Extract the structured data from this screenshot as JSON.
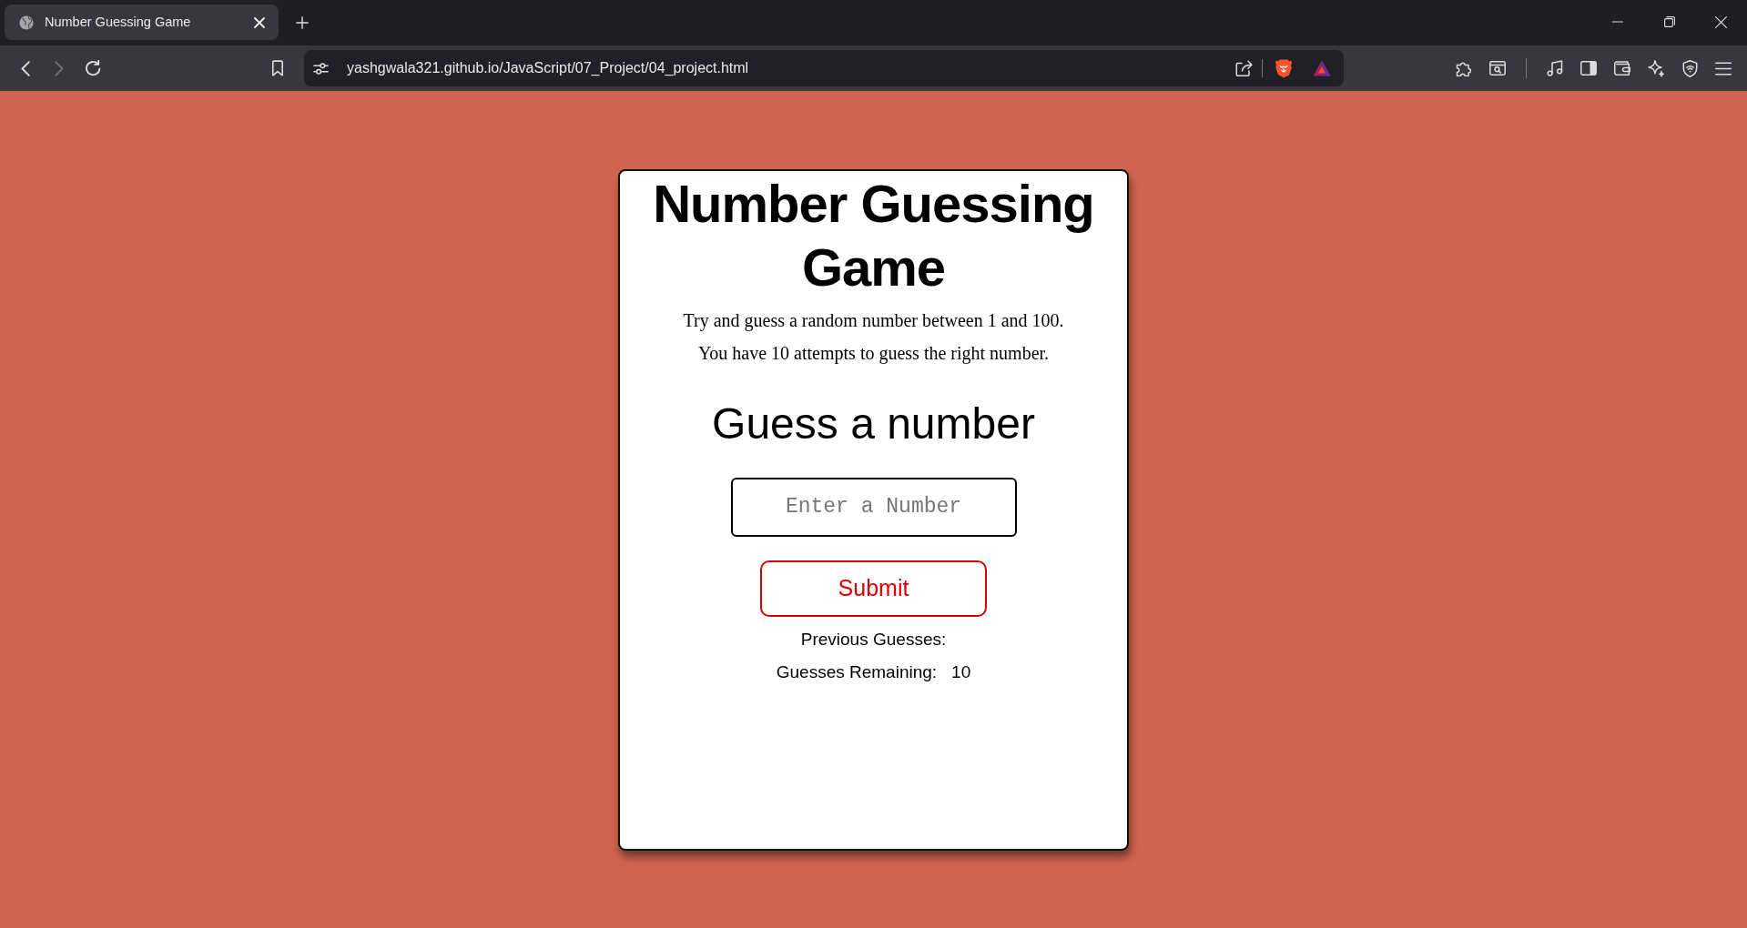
{
  "browser": {
    "tabs": [
      {
        "title": "Number Guessing Game",
        "selected": true
      }
    ],
    "nav_buttons": [
      {
        "kind": "back",
        "disabled": false
      },
      {
        "kind": "forward",
        "disabled": true
      },
      {
        "kind": "reload",
        "disabled": false
      }
    ],
    "address": "yashgwala321.github.io/JavaScript/07_Project/04_project.html"
  },
  "game": {
    "title": "Number Guessing Game",
    "instructions": [
      "Try and guess a random number between 1 and 100.",
      "You have 10 attempts to guess the right number."
    ],
    "prompt": "Guess a number",
    "guess_field": {
      "placeholder": "Enter a Number"
    },
    "submit_button": {
      "label": "Submit"
    },
    "stats": [
      {
        "label": "Previous Guesses:"
      },
      {
        "label": "Guesses Remaining:",
        "value": "10"
      }
    ]
  }
}
